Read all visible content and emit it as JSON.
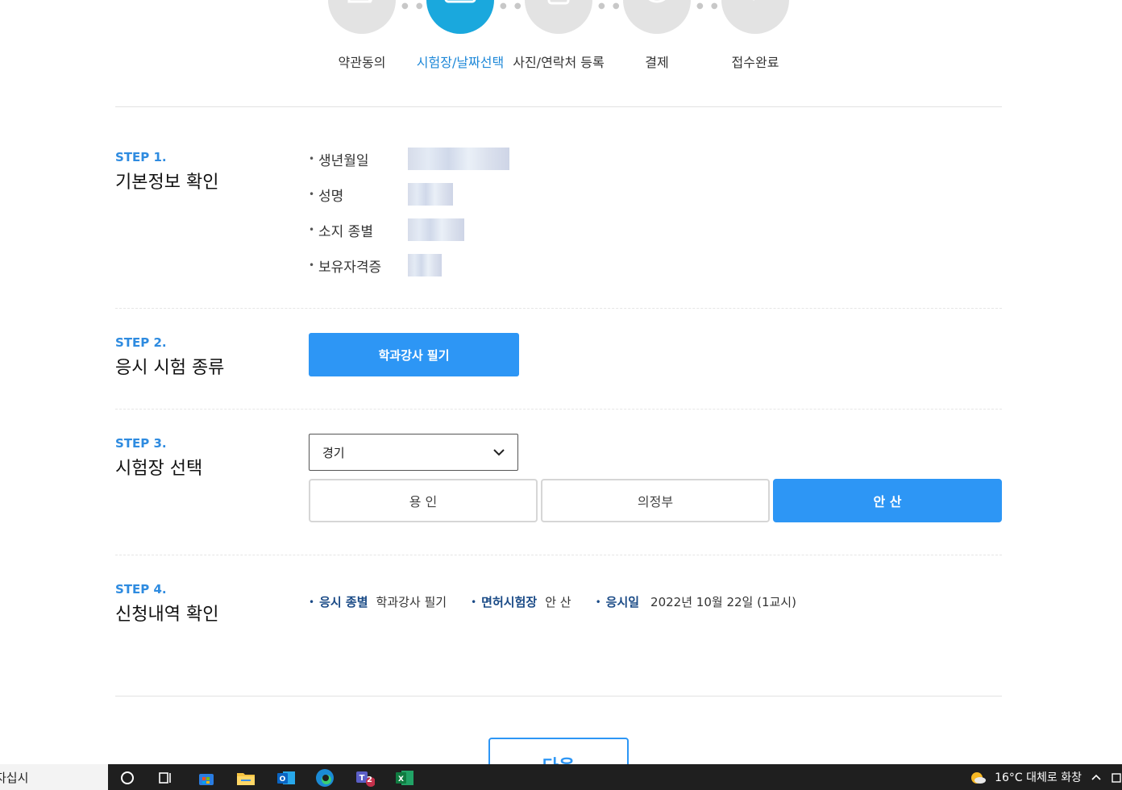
{
  "progress": {
    "steps": [
      {
        "label": "약관동의",
        "icon": "document-icon",
        "active": false
      },
      {
        "label": "시험장/날짜선택",
        "icon": "calendar-icon",
        "active": true
      },
      {
        "label": "사진/연락처 등록",
        "icon": "phone-icon",
        "active": false
      },
      {
        "label": "결제",
        "icon": "won-icon",
        "active": false
      },
      {
        "label": "접수완료",
        "icon": "check-icon",
        "active": false
      }
    ]
  },
  "step1": {
    "number": "STEP 1.",
    "title": "기본정보 확인",
    "fields": [
      {
        "label": "생년월일"
      },
      {
        "label": "성명"
      },
      {
        "label": "소지 종별"
      },
      {
        "label": "보유자격증"
      }
    ]
  },
  "step2": {
    "number": "STEP 2.",
    "title": "응시 시험 종류",
    "exam_button": "학과강사 필기"
  },
  "step3": {
    "number": "STEP 3.",
    "title": "시험장 선택",
    "region_selected": "경기",
    "sites": [
      {
        "label": "용 인",
        "selected": false
      },
      {
        "label": "의정부",
        "selected": false
      },
      {
        "label": "안 산",
        "selected": true
      }
    ]
  },
  "step4": {
    "number": "STEP 4.",
    "title": "신청내역 확인",
    "summary": [
      {
        "key": "응시 종별",
        "value": "학과강사 필기"
      },
      {
        "key": "면허시험장",
        "value": "안 산"
      },
      {
        "key": "응시일",
        "value": "2022년 10월 22일 (1교시)"
      }
    ]
  },
  "next_button": "다음",
  "taskbar": {
    "search_text": "자십시",
    "weather": "16°C  대체로 화창",
    "teams_badge": "2"
  },
  "colors": {
    "accent": "#2d96f5",
    "active_step": "#1aa8dd",
    "label_blue": "#1b4b87"
  }
}
